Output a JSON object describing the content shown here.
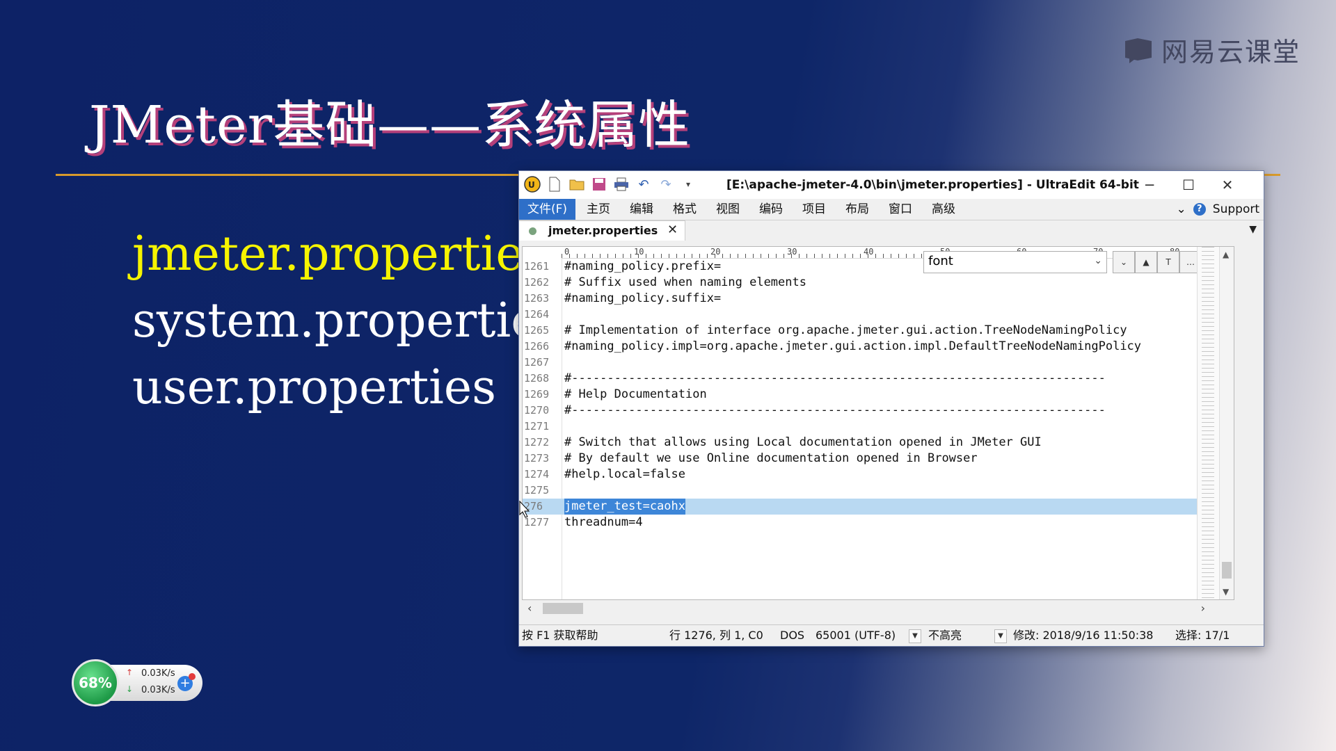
{
  "slide": {
    "title": "JMeter基础——系统属性",
    "brand": "网易云课堂",
    "properties": [
      "jmeter.properties",
      "system.properties",
      "user.properties"
    ],
    "active_index": 0
  },
  "window": {
    "title": "[E:\\apache-jmeter-4.0\\bin\\jmeter.properties] - UltraEdit 64-bit",
    "menu": [
      "文件(F)",
      "主页",
      "编辑",
      "格式",
      "视图",
      "编码",
      "项目",
      "布局",
      "窗口",
      "高级"
    ],
    "support": "Support",
    "tab": "jmeter.properties",
    "ruler": [
      "0",
      "10",
      "20",
      "30",
      "40",
      "50",
      "60",
      "70",
      "80"
    ],
    "find": {
      "value": "font"
    },
    "lines": [
      {
        "n": "1261",
        "t": "#naming_policy.prefix="
      },
      {
        "n": "1262",
        "t": "# Suffix used when naming elements"
      },
      {
        "n": "1263",
        "t": "#naming_policy.suffix="
      },
      {
        "n": "1264",
        "t": ""
      },
      {
        "n": "1265",
        "t": "# Implementation of interface org.apache.jmeter.gui.action.TreeNodeNamingPolicy"
      },
      {
        "n": "1266",
        "t": "#naming_policy.impl=org.apache.jmeter.gui.action.impl.DefaultTreeNodeNamingPolicy"
      },
      {
        "n": "1267",
        "t": ""
      },
      {
        "n": "1268",
        "t": "#---------------------------------------------------------------------------"
      },
      {
        "n": "1269",
        "t": "# Help Documentation"
      },
      {
        "n": "1270",
        "t": "#---------------------------------------------------------------------------"
      },
      {
        "n": "1271",
        "t": ""
      },
      {
        "n": "1272",
        "t": "# Switch that allows using Local documentation opened in JMeter GUI"
      },
      {
        "n": "1273",
        "t": "# By default we use Online documentation opened in Browser"
      },
      {
        "n": "1274",
        "t": "#help.local=false"
      },
      {
        "n": "1275",
        "t": ""
      },
      {
        "n": "276",
        "t": "jmeter_test=caohx",
        "highlight": true
      },
      {
        "n": "1277",
        "t": "threadnum=4"
      }
    ],
    "status": {
      "help": "按 F1 获取帮助",
      "position": "行 1276, 列 1, C0",
      "line_ending": "DOS",
      "encoding": "65001 (UTF-8)",
      "highlight": "不高亮",
      "modified": "修改:   2018/9/16 11:50:38",
      "selection": "选择: 17/1"
    }
  },
  "network": {
    "percent": "68%",
    "up": "0.03K/s",
    "down": "0.03K/s"
  },
  "colors": {
    "accent": "#f6f400",
    "selection": "#3d86d8",
    "menu_active": "#2e6fc8"
  }
}
